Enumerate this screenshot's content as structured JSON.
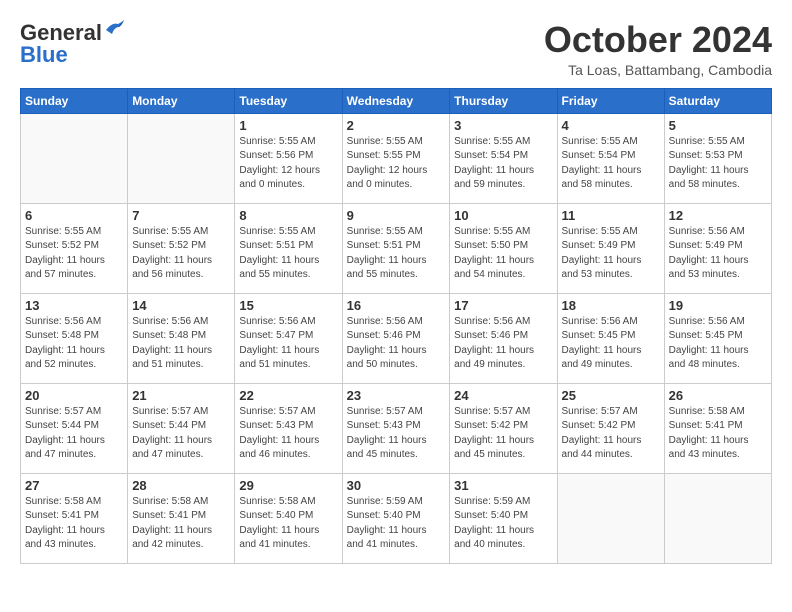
{
  "header": {
    "logo_general": "General",
    "logo_blue": "Blue",
    "month_title": "October 2024",
    "location": "Ta Loas, Battambang, Cambodia"
  },
  "days_of_week": [
    "Sunday",
    "Monday",
    "Tuesday",
    "Wednesday",
    "Thursday",
    "Friday",
    "Saturday"
  ],
  "weeks": [
    [
      {
        "day": "",
        "info": ""
      },
      {
        "day": "",
        "info": ""
      },
      {
        "day": "1",
        "info": "Sunrise: 5:55 AM\nSunset: 5:56 PM\nDaylight: 12 hours\nand 0 minutes."
      },
      {
        "day": "2",
        "info": "Sunrise: 5:55 AM\nSunset: 5:55 PM\nDaylight: 12 hours\nand 0 minutes."
      },
      {
        "day": "3",
        "info": "Sunrise: 5:55 AM\nSunset: 5:54 PM\nDaylight: 11 hours\nand 59 minutes."
      },
      {
        "day": "4",
        "info": "Sunrise: 5:55 AM\nSunset: 5:54 PM\nDaylight: 11 hours\nand 58 minutes."
      },
      {
        "day": "5",
        "info": "Sunrise: 5:55 AM\nSunset: 5:53 PM\nDaylight: 11 hours\nand 58 minutes."
      }
    ],
    [
      {
        "day": "6",
        "info": "Sunrise: 5:55 AM\nSunset: 5:52 PM\nDaylight: 11 hours\nand 57 minutes."
      },
      {
        "day": "7",
        "info": "Sunrise: 5:55 AM\nSunset: 5:52 PM\nDaylight: 11 hours\nand 56 minutes."
      },
      {
        "day": "8",
        "info": "Sunrise: 5:55 AM\nSunset: 5:51 PM\nDaylight: 11 hours\nand 55 minutes."
      },
      {
        "day": "9",
        "info": "Sunrise: 5:55 AM\nSunset: 5:51 PM\nDaylight: 11 hours\nand 55 minutes."
      },
      {
        "day": "10",
        "info": "Sunrise: 5:55 AM\nSunset: 5:50 PM\nDaylight: 11 hours\nand 54 minutes."
      },
      {
        "day": "11",
        "info": "Sunrise: 5:55 AM\nSunset: 5:49 PM\nDaylight: 11 hours\nand 53 minutes."
      },
      {
        "day": "12",
        "info": "Sunrise: 5:56 AM\nSunset: 5:49 PM\nDaylight: 11 hours\nand 53 minutes."
      }
    ],
    [
      {
        "day": "13",
        "info": "Sunrise: 5:56 AM\nSunset: 5:48 PM\nDaylight: 11 hours\nand 52 minutes."
      },
      {
        "day": "14",
        "info": "Sunrise: 5:56 AM\nSunset: 5:48 PM\nDaylight: 11 hours\nand 51 minutes."
      },
      {
        "day": "15",
        "info": "Sunrise: 5:56 AM\nSunset: 5:47 PM\nDaylight: 11 hours\nand 51 minutes."
      },
      {
        "day": "16",
        "info": "Sunrise: 5:56 AM\nSunset: 5:46 PM\nDaylight: 11 hours\nand 50 minutes."
      },
      {
        "day": "17",
        "info": "Sunrise: 5:56 AM\nSunset: 5:46 PM\nDaylight: 11 hours\nand 49 minutes."
      },
      {
        "day": "18",
        "info": "Sunrise: 5:56 AM\nSunset: 5:45 PM\nDaylight: 11 hours\nand 49 minutes."
      },
      {
        "day": "19",
        "info": "Sunrise: 5:56 AM\nSunset: 5:45 PM\nDaylight: 11 hours\nand 48 minutes."
      }
    ],
    [
      {
        "day": "20",
        "info": "Sunrise: 5:57 AM\nSunset: 5:44 PM\nDaylight: 11 hours\nand 47 minutes."
      },
      {
        "day": "21",
        "info": "Sunrise: 5:57 AM\nSunset: 5:44 PM\nDaylight: 11 hours\nand 47 minutes."
      },
      {
        "day": "22",
        "info": "Sunrise: 5:57 AM\nSunset: 5:43 PM\nDaylight: 11 hours\nand 46 minutes."
      },
      {
        "day": "23",
        "info": "Sunrise: 5:57 AM\nSunset: 5:43 PM\nDaylight: 11 hours\nand 45 minutes."
      },
      {
        "day": "24",
        "info": "Sunrise: 5:57 AM\nSunset: 5:42 PM\nDaylight: 11 hours\nand 45 minutes."
      },
      {
        "day": "25",
        "info": "Sunrise: 5:57 AM\nSunset: 5:42 PM\nDaylight: 11 hours\nand 44 minutes."
      },
      {
        "day": "26",
        "info": "Sunrise: 5:58 AM\nSunset: 5:41 PM\nDaylight: 11 hours\nand 43 minutes."
      }
    ],
    [
      {
        "day": "27",
        "info": "Sunrise: 5:58 AM\nSunset: 5:41 PM\nDaylight: 11 hours\nand 43 minutes."
      },
      {
        "day": "28",
        "info": "Sunrise: 5:58 AM\nSunset: 5:41 PM\nDaylight: 11 hours\nand 42 minutes."
      },
      {
        "day": "29",
        "info": "Sunrise: 5:58 AM\nSunset: 5:40 PM\nDaylight: 11 hours\nand 41 minutes."
      },
      {
        "day": "30",
        "info": "Sunrise: 5:59 AM\nSunset: 5:40 PM\nDaylight: 11 hours\nand 41 minutes."
      },
      {
        "day": "31",
        "info": "Sunrise: 5:59 AM\nSunset: 5:40 PM\nDaylight: 11 hours\nand 40 minutes."
      },
      {
        "day": "",
        "info": ""
      },
      {
        "day": "",
        "info": ""
      }
    ]
  ]
}
